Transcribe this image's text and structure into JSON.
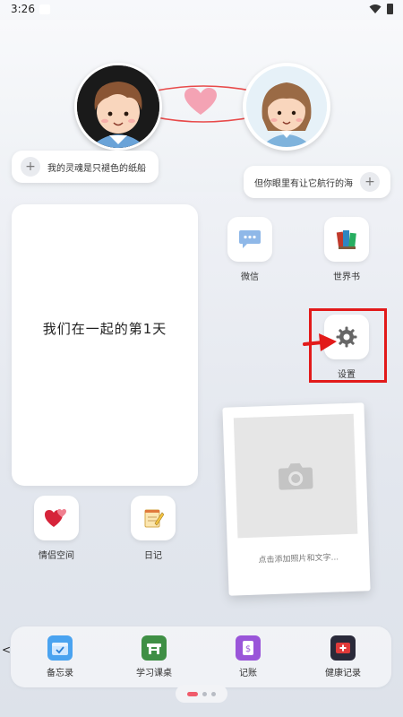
{
  "status_bar": {
    "time": "3:26"
  },
  "top_widget": {
    "left_bubble": "我的灵魂是只褪色的纸船",
    "right_bubble": "但你眼里有让它航行的海"
  },
  "big_widget": {
    "text": "我们在一起的第1天"
  },
  "apps": {
    "wechat": "微信",
    "world_book": "世界书",
    "settings": "设置",
    "couple_space": "情侣空间",
    "diary": "日记"
  },
  "photo_card": {
    "caption": "点击添加照片和文字..."
  },
  "dock": [
    {
      "label": "备忘录",
      "icon": "memo-icon",
      "color": "#4aa3f0"
    },
    {
      "label": "学习课桌",
      "icon": "study-desk-icon",
      "color": "#3f8f45"
    },
    {
      "label": "记账",
      "icon": "accounting-icon",
      "color": "#9a55d9"
    },
    {
      "label": "健康记录",
      "icon": "health-icon",
      "color": "#2a2a3a"
    }
  ],
  "colors": {
    "accent_red": "#e21a1a",
    "heart_pink": "#f4a3b4",
    "active_dot": "#f05b6b"
  },
  "page_indicator": {
    "pages": 3,
    "active": 1
  }
}
